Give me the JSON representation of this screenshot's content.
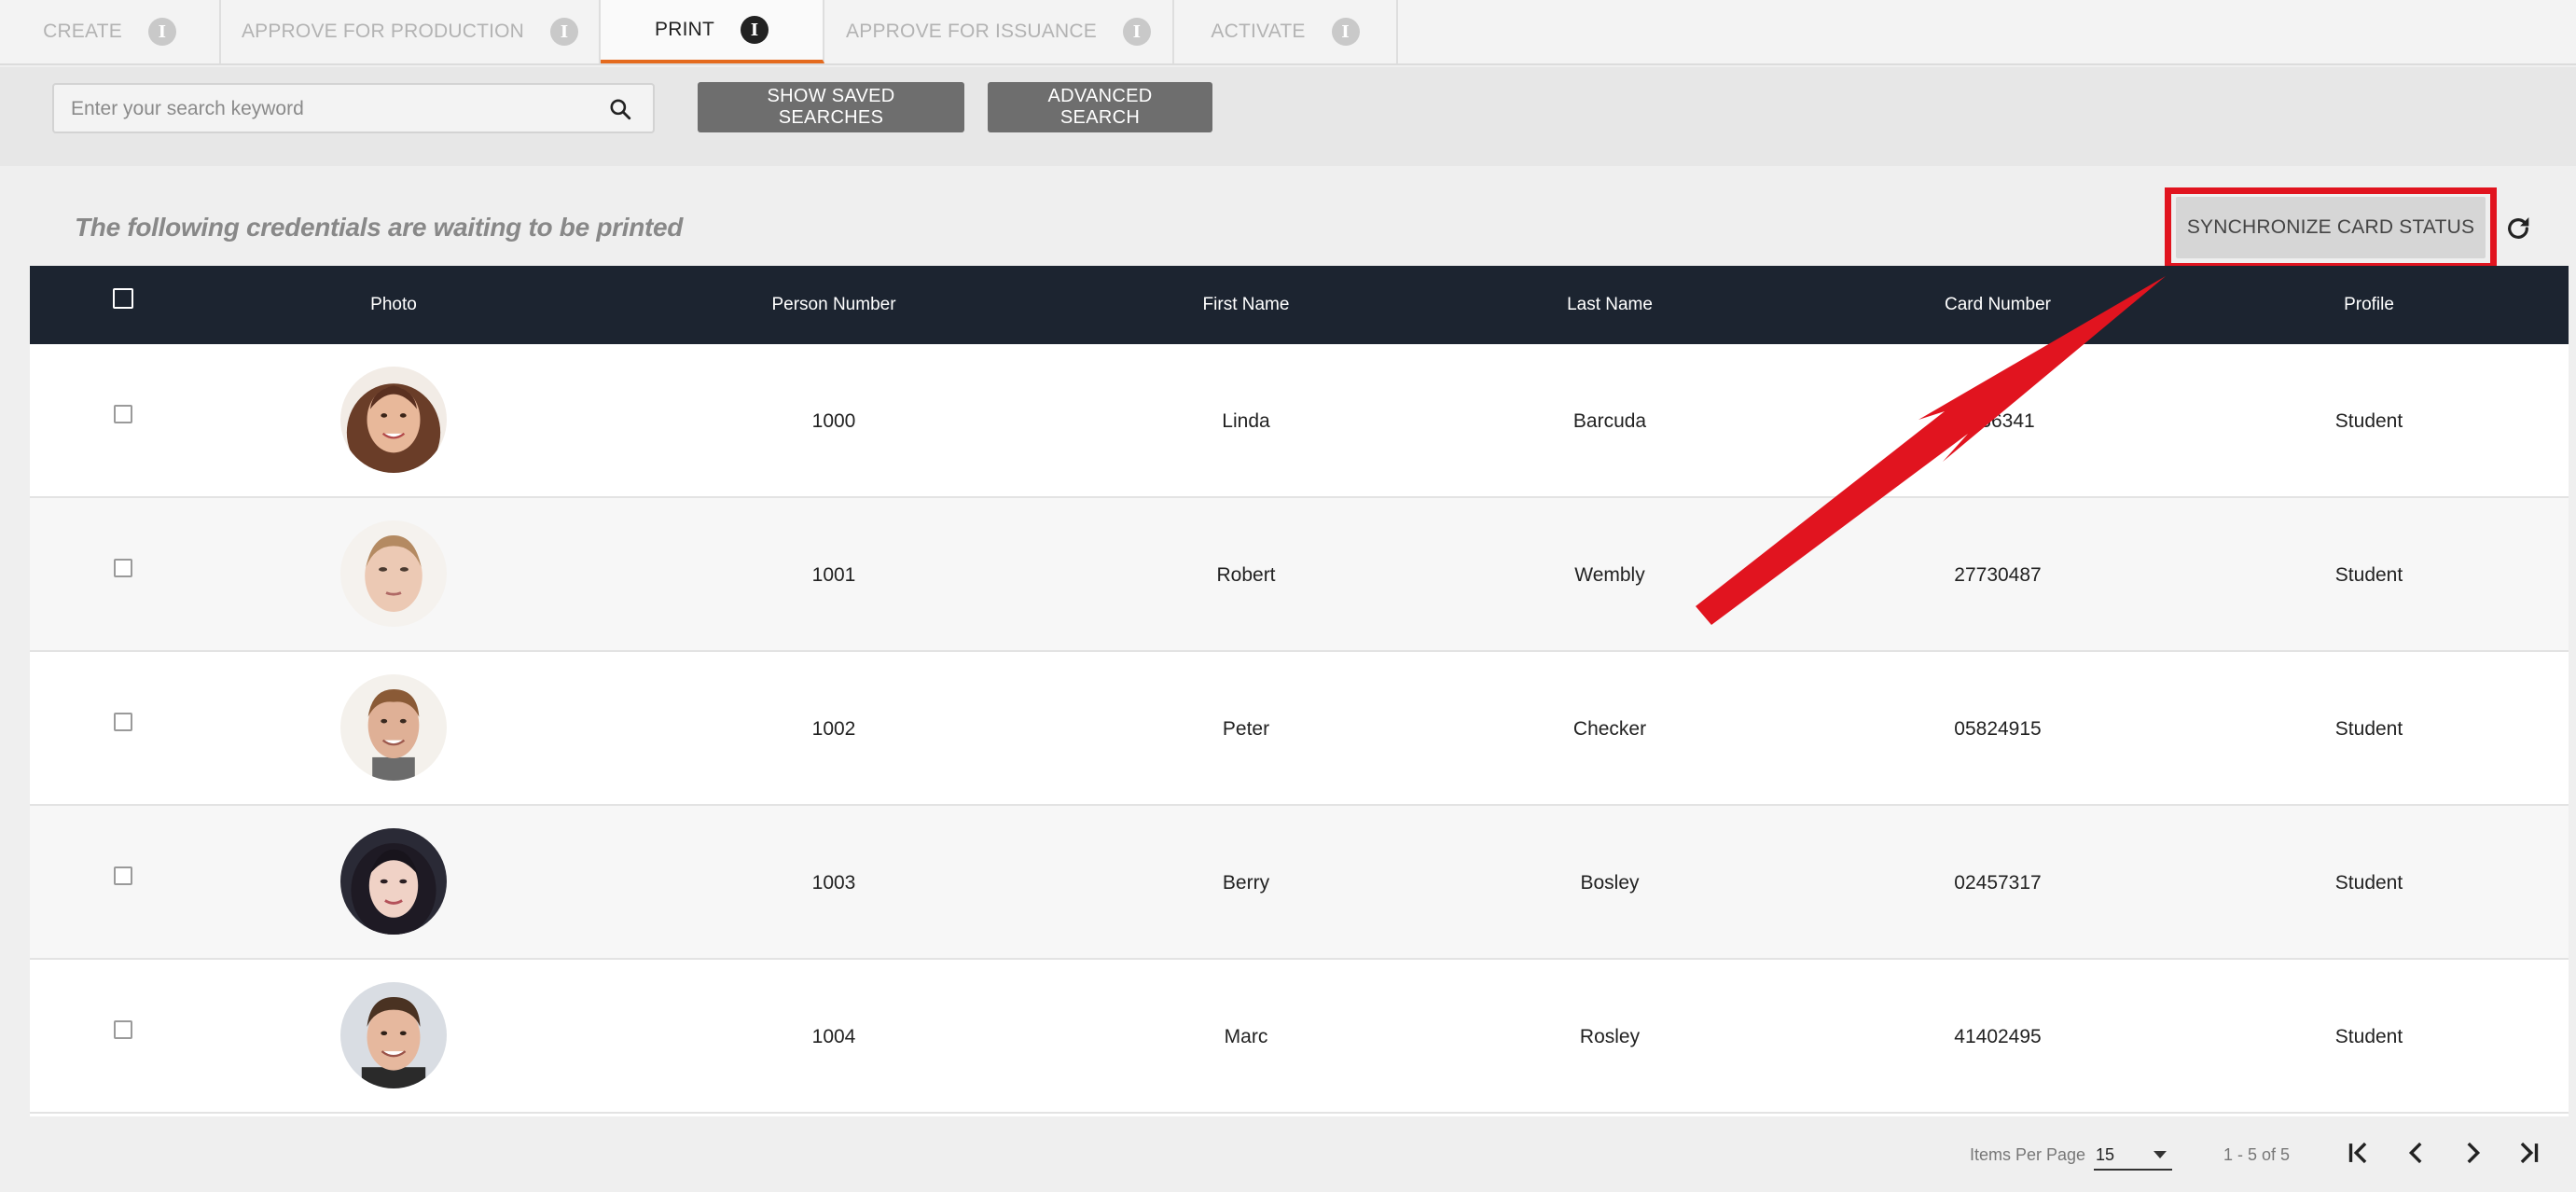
{
  "tabs": [
    {
      "label": "CREATE",
      "active": false
    },
    {
      "label": "APPROVE FOR PRODUCTION",
      "active": false
    },
    {
      "label": "PRINT",
      "active": true
    },
    {
      "label": "APPROVE FOR ISSUANCE",
      "active": false
    },
    {
      "label": "ACTIVATE",
      "active": false
    }
  ],
  "search": {
    "placeholder": "Enter your search keyword",
    "value": "",
    "show_saved_label": "SHOW SAVED SEARCHES",
    "advanced_label": "ADVANCED SEARCH"
  },
  "subtitle": "The following credentials are waiting to be printed",
  "sync_button_label": "SYNCHRONIZE CARD STATUS",
  "table": {
    "columns": [
      "Photo",
      "Person Number",
      "First Name",
      "Last Name",
      "Card Number",
      "Profile"
    ],
    "rows": [
      {
        "person_number": "1000",
        "first_name": "Linda",
        "last_name": "Barcuda",
        "card_number": "…36341",
        "profile": "Student",
        "avatar": "female-portrait-1"
      },
      {
        "person_number": "1001",
        "first_name": "Robert",
        "last_name": "Wembly",
        "card_number": "27730487",
        "profile": "Student",
        "avatar": "female-portrait-2"
      },
      {
        "person_number": "1002",
        "first_name": "Peter",
        "last_name": "Checker",
        "card_number": "05824915",
        "profile": "Student",
        "avatar": "male-portrait-1"
      },
      {
        "person_number": "1003",
        "first_name": "Berry",
        "last_name": "Bosley",
        "card_number": "02457317",
        "profile": "Student",
        "avatar": "female-portrait-3"
      },
      {
        "person_number": "1004",
        "first_name": "Marc",
        "last_name": "Rosley",
        "card_number": "41402495",
        "profile": "Student",
        "avatar": "male-portrait-2"
      }
    ]
  },
  "pagination": {
    "items_per_page_label": "Items Per Page",
    "items_per_page_value": "15",
    "range_text": "1 - 5 of 5"
  },
  "colors": {
    "active_tab_accent": "#e46a1e",
    "table_header": "#1c2430",
    "annotation_red": "#e1141f"
  },
  "icons": [
    "info-icon",
    "search-icon",
    "refresh-icon",
    "first-page-icon",
    "prev-page-icon",
    "next-page-icon",
    "last-page-icon"
  ]
}
